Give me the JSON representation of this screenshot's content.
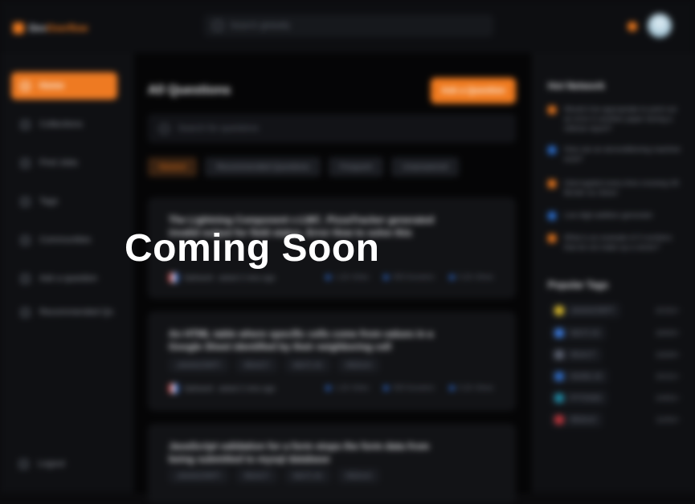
{
  "overlay": {
    "headline": "Coming Soon"
  },
  "brand": {
    "name_part1": "Dev",
    "name_part2": "Overflow",
    "accent_color": "#f07a1e"
  },
  "header": {
    "search_placeholder": "Search globally"
  },
  "sidebar": {
    "items": [
      {
        "label": "Home",
        "active": true
      },
      {
        "label": "Collections"
      },
      {
        "label": "Find Jobs"
      },
      {
        "label": "Tags"
      },
      {
        "label": "Communities"
      },
      {
        "label": "Ask a question"
      },
      {
        "label": "Recommended Qs"
      }
    ],
    "logout_label": "Logout"
  },
  "main": {
    "title": "All Questions",
    "ask_button": "Ask a Question",
    "search_placeholder": "Search for questions",
    "filters": [
      {
        "label": "Newest",
        "active": true
      },
      {
        "label": "Recommended Questions"
      },
      {
        "label": "Frequent"
      },
      {
        "label": "Unanswered"
      }
    ],
    "questions": [
      {
        "title": "The Lightning Component c:LWC_PizzaTracker generated invalid output for field status. Error How to solve this",
        "tags": [],
        "author": "Satheesh",
        "time": "asked 2 mins ago",
        "stats": [
          "1.2k Votes",
          "900 Answers",
          "5.2k Views"
        ]
      },
      {
        "title": "An HTML table where specific cells come from values in a Google Sheet identified by their neighboring cell",
        "tags": [
          "JAVASCRIPT",
          "REACT",
          "NEXT.JS",
          "REDUX"
        ],
        "author": "Satheesh",
        "time": "asked 2 mins ago",
        "stats": [
          "1.2k Votes",
          "900 Answers",
          "5.2k Views"
        ]
      },
      {
        "title": "JavaScript validation for a form stops the form data from being submitted to mysql database",
        "tags": [
          "JAVASCRIPT",
          "REACT",
          "NEXT.JS",
          "REDUX"
        ],
        "author": "",
        "time": "",
        "stats": []
      }
    ]
  },
  "rightbar": {
    "hot_title": "Hot Network",
    "hot_items": [
      {
        "text": "Would it be appropriate to point out an error in another paper during a referee report?",
        "color": "#f07a1e"
      },
      {
        "text": "How can an airconditioning machine exist?",
        "color": "#2b6fd0"
      },
      {
        "text": "Interrogated every time crossing UK Border as citizen",
        "color": "#f07a1e"
      },
      {
        "text": "Low digit addition generator",
        "color": "#2b6fd0"
      },
      {
        "text": "What is an example of 3 numbers that do not make up a vector?",
        "color": "#f07a1e"
      }
    ],
    "tags_title": "Popular Tags",
    "popular_tags": [
      {
        "name": "JAVASCRIPT",
        "count": "20152+",
        "color": "#e2c02a"
      },
      {
        "name": "NEXT.JS",
        "count": "18493+",
        "color": "#3a7be0"
      },
      {
        "name": "REACT",
        "count": "16269+",
        "color": "#5b6170"
      },
      {
        "name": "NODE.JS",
        "count": "15121+",
        "color": "#2e6cc7"
      },
      {
        "name": "PYTHON",
        "count": "14431+",
        "color": "#1e8aa6"
      },
      {
        "name": "REDUX",
        "count": "11002+",
        "color": "#c2343a"
      }
    ]
  }
}
